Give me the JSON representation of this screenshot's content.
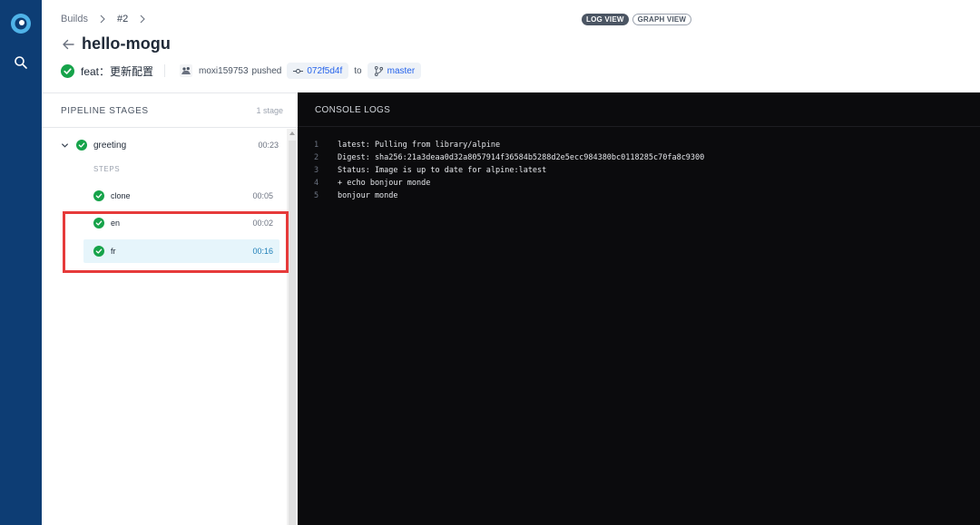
{
  "breadcrumb": {
    "builds": "Builds",
    "build_number": "#2"
  },
  "repo_title": "hello-mogu",
  "commit": {
    "message": "feat：更新配置",
    "author": "moxi159753",
    "action": "pushed",
    "sha": "072f5d4f",
    "to": "to",
    "branch": "master"
  },
  "view_toggle": {
    "log_view": "LOG VIEW",
    "graph_view": "GRAPH VIEW",
    "active": "log_view"
  },
  "pipeline": {
    "heading": "PIPELINE STAGES",
    "stage_count": "1 stage",
    "stage": {
      "name": "greeting",
      "duration": "00:23",
      "status": "success"
    },
    "steps_label": "STEPS",
    "steps": [
      {
        "name": "clone",
        "duration": "00:05",
        "status": "success",
        "selected": false
      },
      {
        "name": "en",
        "duration": "00:02",
        "status": "success",
        "selected": false
      },
      {
        "name": "fr",
        "duration": "00:16",
        "status": "success",
        "selected": true
      }
    ]
  },
  "console": {
    "heading": "CONSOLE LOGS",
    "lines": [
      {
        "num": "1",
        "text": "latest: Pulling from library/alpine"
      },
      {
        "num": "2",
        "text": "Digest: sha256:21a3deaa0d32a8057914f36584b5288d2e5ecc984380bc0118285c70fa8c9300"
      },
      {
        "num": "3",
        "text": "Status: Image is up to date for alpine:latest"
      },
      {
        "num": "4",
        "text": "+ echo bonjour monde"
      },
      {
        "num": "5",
        "text": "bonjour monde"
      }
    ]
  },
  "colors": {
    "rail": "#0d3d74",
    "success": "#16a34a",
    "link": "#2563eb",
    "console_bg": "#0b0b0d",
    "highlight": "#e63a3a"
  }
}
